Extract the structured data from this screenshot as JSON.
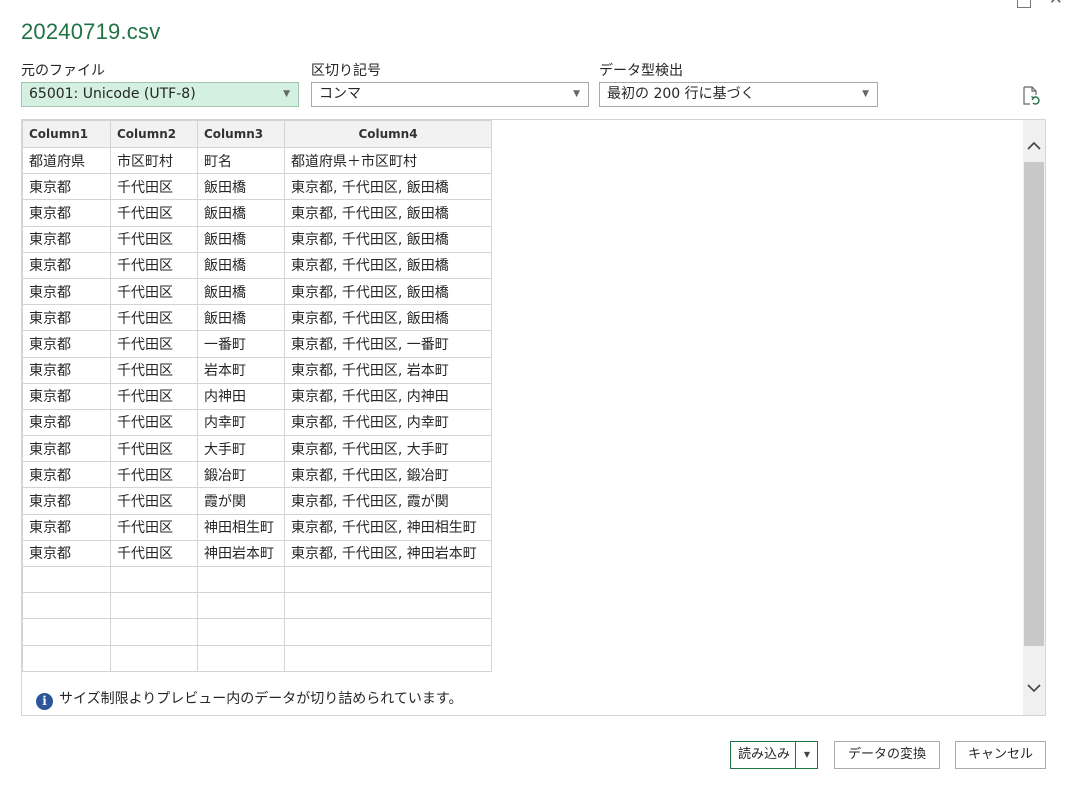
{
  "window": {
    "title": "20240719.csv"
  },
  "controls": {
    "file_origin": {
      "label": "元のファイル",
      "value": "65001: Unicode (UTF-8)"
    },
    "delimiter": {
      "label": "区切り記号",
      "value": "コンマ"
    },
    "type_detection": {
      "label": "データ型検出",
      "value": "最初の 200 行に基づく"
    }
  },
  "table": {
    "headers": [
      "Column1",
      "Column2",
      "Column3",
      "Column4"
    ],
    "rows": [
      [
        "都道府県",
        "市区町村",
        "町名",
        "都道府県＋市区町村"
      ],
      [
        "東京都",
        "千代田区",
        "飯田橋",
        "東京都, 千代田区, 飯田橋"
      ],
      [
        "東京都",
        "千代田区",
        "飯田橋",
        "東京都, 千代田区, 飯田橋"
      ],
      [
        "東京都",
        "千代田区",
        "飯田橋",
        "東京都, 千代田区, 飯田橋"
      ],
      [
        "東京都",
        "千代田区",
        "飯田橋",
        "東京都, 千代田区, 飯田橋"
      ],
      [
        "東京都",
        "千代田区",
        "飯田橋",
        "東京都, 千代田区, 飯田橋"
      ],
      [
        "東京都",
        "千代田区",
        "飯田橋",
        "東京都, 千代田区, 飯田橋"
      ],
      [
        "東京都",
        "千代田区",
        "一番町",
        "東京都, 千代田区, 一番町"
      ],
      [
        "東京都",
        "千代田区",
        "岩本町",
        "東京都, 千代田区, 岩本町"
      ],
      [
        "東京都",
        "千代田区",
        "内神田",
        "東京都, 千代田区, 内神田"
      ],
      [
        "東京都",
        "千代田区",
        "内幸町",
        "東京都, 千代田区, 内幸町"
      ],
      [
        "東京都",
        "千代田区",
        "大手町",
        "東京都, 千代田区, 大手町"
      ],
      [
        "東京都",
        "千代田区",
        "鍛冶町",
        "東京都, 千代田区, 鍛冶町"
      ],
      [
        "東京都",
        "千代田区",
        "霞が関",
        "東京都, 千代田区, 霞が関"
      ],
      [
        "東京都",
        "千代田区",
        "神田相生町",
        "東京都, 千代田区, 神田相生町"
      ],
      [
        "東京都",
        "千代田区",
        "神田岩本町",
        "東京都, 千代田区, 神田岩本町"
      ],
      [
        "",
        "",
        "",
        ""
      ],
      [
        "",
        "",
        "",
        ""
      ],
      [
        "",
        "",
        "",
        ""
      ],
      [
        "",
        "",
        "",
        ""
      ]
    ]
  },
  "notice": {
    "text": "サイズ制限よりプレビュー内のデータが切り詰められています。",
    "icon": "info-icon"
  },
  "buttons": {
    "load": "読み込み",
    "transform": "データの変換",
    "cancel": "キャンセル"
  },
  "colors": {
    "accent": "#217346",
    "selected_bg": "#d3f0e0",
    "info_icon": "#2b579a"
  }
}
